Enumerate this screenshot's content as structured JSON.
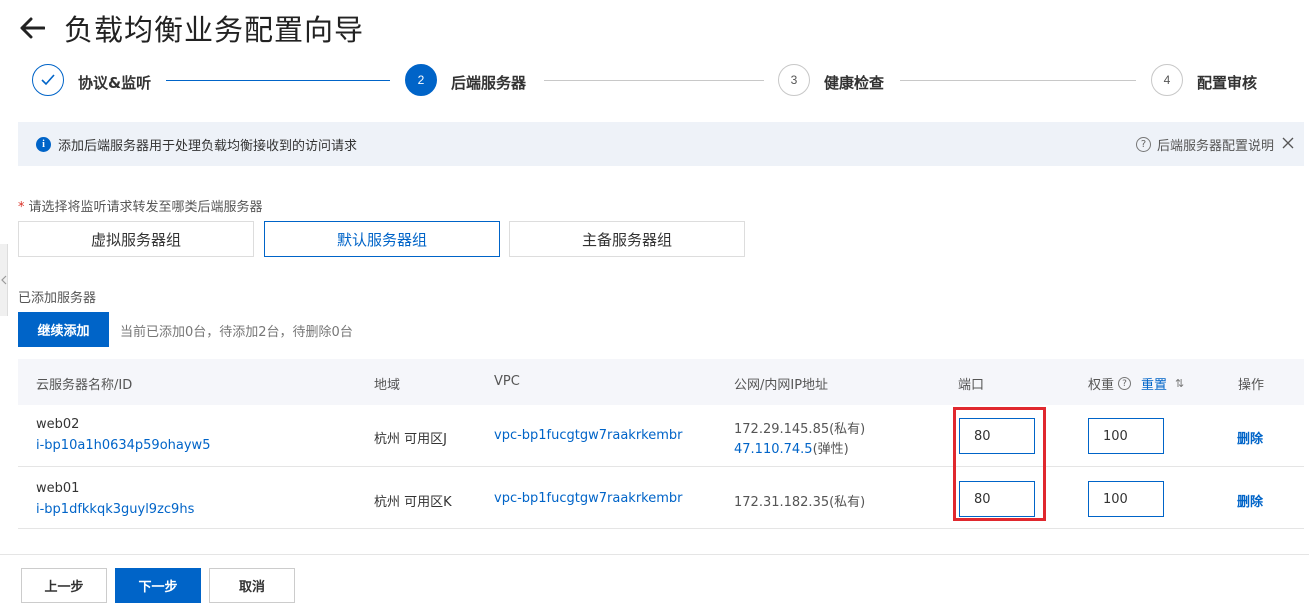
{
  "header": {
    "title": "负载均衡业务配置向导"
  },
  "steps": [
    {
      "number": "",
      "label": "协议&监听",
      "state": "done"
    },
    {
      "number": "2",
      "label": "后端服务器",
      "state": "active"
    },
    {
      "number": "3",
      "label": "健康检查",
      "state": "todo"
    },
    {
      "number": "4",
      "label": "配置审核",
      "state": "todo"
    }
  ],
  "notice": {
    "icon": "info-icon",
    "text": "添加后端服务器用于处理负载均衡接收到的访问请求",
    "help_link": "后端服务器配置说明"
  },
  "server_type": {
    "label": "请选择将监听请求转发至哪类后端服务器",
    "options": [
      "虚拟服务器组",
      "默认服务器组",
      "主备服务器组"
    ],
    "selected": "默认服务器组"
  },
  "added": {
    "label": "已添加服务器",
    "continue_button": "继续添加",
    "status": "当前已添加0台，待添加2台，待删除0台"
  },
  "table": {
    "headers": {
      "name": "云服务器名称/ID",
      "region": "地域",
      "vpc": "VPC",
      "ip": "公网/内网IP地址",
      "port": "端口",
      "weight": "权重",
      "reset": "重置",
      "action": "操作"
    },
    "rows": [
      {
        "name": "web02",
        "id": "i-bp10a1h0634p59ohayw5",
        "region": "杭州 可用区J",
        "vpc": "vpc-bp1fucgtgw7raakrkembr",
        "ip_private": "172.29.145.85(私有)",
        "ip_public": "47.110.74.5",
        "ip_public_suffix": "(弹性)",
        "port": "80",
        "weight": "100",
        "action": "删除"
      },
      {
        "name": "web01",
        "id": "i-bp1dfkkqk3guyl9zc9hs",
        "region": "杭州 可用区K",
        "vpc": "vpc-bp1fucgtgw7raakrkembr",
        "ip_private": "172.31.182.35(私有)",
        "port": "80",
        "weight": "100",
        "action": "删除"
      }
    ]
  },
  "footer": {
    "prev": "上一步",
    "next": "下一步",
    "cancel": "取消"
  },
  "colors": {
    "primary": "#0064c8",
    "highlight": "#e0282e",
    "notice_bg": "#eef2f8"
  }
}
